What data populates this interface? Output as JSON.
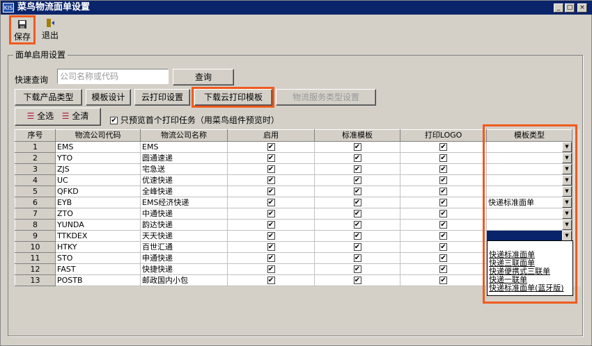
{
  "window": {
    "title": "菜鸟物流面单设置",
    "logo": "KIS"
  },
  "toolbar": {
    "save": "保存",
    "exit": "退出"
  },
  "group": {
    "title": "面单启用设置"
  },
  "search": {
    "label": "快速查询",
    "placeholder": "公司名称或代码",
    "button": "查询"
  },
  "buttons": {
    "download_types": "下载产品类型",
    "template_design": "模板设计",
    "cloud_print": "云打印设置",
    "download_templates": "下载云打印模板",
    "service_types": "物流服务类型设置"
  },
  "select_all": "全选",
  "clear_all": "全清",
  "preview_only_first": {
    "label": "只预览首个打印任务（用菜鸟组件预览时）",
    "checked": true
  },
  "table": {
    "headers": [
      "序号",
      "物流公司代码",
      "物流公司名称",
      "启用",
      "标准模板",
      "打印LOGO",
      "模板类型"
    ],
    "rows": [
      {
        "no": "1",
        "code": "EMS",
        "name": "EMS",
        "type": ""
      },
      {
        "no": "2",
        "code": "YTO",
        "name": "圆通速递",
        "type": ""
      },
      {
        "no": "3",
        "code": "ZJS",
        "name": "宅急送",
        "type": ""
      },
      {
        "no": "4",
        "code": "UC",
        "name": "优速快递",
        "type": ""
      },
      {
        "no": "5",
        "code": "QFKD",
        "name": "全峰快递",
        "type": ""
      },
      {
        "no": "6",
        "code": "EYB",
        "name": "EMS经济快递",
        "type": "快递标准面单"
      },
      {
        "no": "7",
        "code": "ZTO",
        "name": "中通快递",
        "type": ""
      },
      {
        "no": "8",
        "code": "YUNDA",
        "name": "韵达快递",
        "type": ""
      },
      {
        "no": "9",
        "code": "TTKDEX",
        "name": "天天快递",
        "type": ""
      },
      {
        "no": "10",
        "code": "HTKY",
        "name": "百世汇通",
        "type": ""
      },
      {
        "no": "11",
        "code": "STO",
        "name": "申通快递",
        "type": ""
      },
      {
        "no": "12",
        "code": "FAST",
        "name": "快捷快递",
        "type": ""
      },
      {
        "no": "13",
        "code": "POSTB",
        "name": "邮政国内小包",
        "type": ""
      }
    ]
  },
  "dropdown_options": [
    "快递标准面单",
    "快递三联面单",
    "快递便携式三联单",
    "快递一联单",
    "快递标准面单(蓝牙版)"
  ]
}
